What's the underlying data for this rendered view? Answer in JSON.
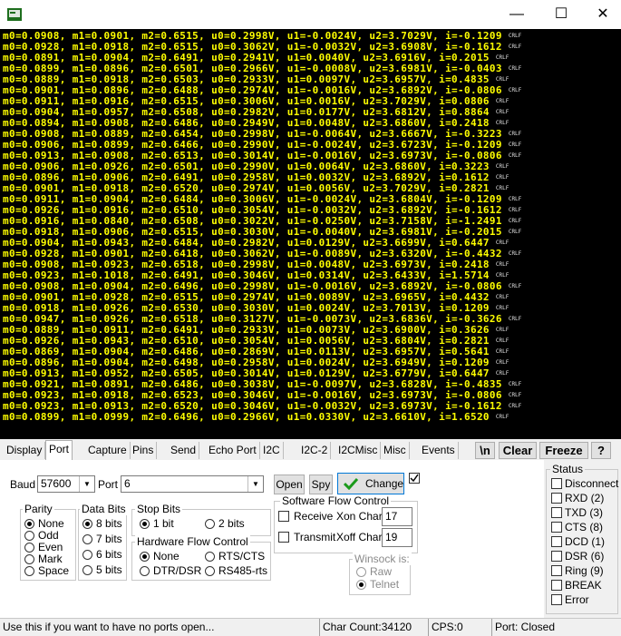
{
  "window": {
    "minimize": "—",
    "maximize": "☐",
    "close": "✕"
  },
  "terminal": {
    "crlf": "CRLF",
    "lines": [
      "m0=0.0908, m1=0.0901, m2=0.6515, u0=0.2998V, u1=-0.0024V, u2=3.7029V, i=-0.1209",
      "m0=0.0928, m1=0.0918, m2=0.6515, u0=0.3062V, u1=-0.0032V, u2=3.6908V, i=-0.1612",
      "m0=0.0891, m1=0.0904, m2=0.6491, u0=0.2941V, u1=0.0040V, u2=3.6916V, i=0.2015",
      "m0=0.0899, m1=0.0896, m2=0.6501, u0=0.2966V, u1=-0.0008V, u2=3.6981V, i=-0.0403",
      "m0=0.0889, m1=0.0918, m2=0.6503, u0=0.2933V, u1=0.0097V, u2=3.6957V, i=0.4835",
      "m0=0.0901, m1=0.0896, m2=0.6488, u0=0.2974V, u1=-0.0016V, u2=3.6892V, i=-0.0806",
      "m0=0.0911, m1=0.0916, m2=0.6515, u0=0.3006V, u1=0.0016V, u2=3.7029V, i=0.0806",
      "m0=0.0904, m1=0.0957, m2=0.6508, u0=0.2982V, u1=0.0177V, u2=3.6812V, i=0.8864",
      "m0=0.0894, m1=0.0908, m2=0.6486, u0=0.2949V, u1=0.0048V, u2=3.6860V, i=0.2418",
      "m0=0.0908, m1=0.0889, m2=0.6454, u0=0.2998V, u1=-0.0064V, u2=3.6667V, i=-0.3223",
      "m0=0.0906, m1=0.0899, m2=0.6466, u0=0.2990V, u1=-0.0024V, u2=3.6723V, i=-0.1209",
      "m0=0.0913, m1=0.0908, m2=0.6513, u0=0.3014V, u1=-0.0016V, u2=3.6973V, i=-0.0806",
      "m0=0.0906, m1=0.0926, m2=0.6501, u0=0.2990V, u1=0.0064V, u2=3.6860V, i=0.3223",
      "m0=0.0896, m1=0.0906, m2=0.6491, u0=0.2958V, u1=0.0032V, u2=3.6892V, i=0.1612",
      "m0=0.0901, m1=0.0918, m2=0.6520, u0=0.2974V, u1=0.0056V, u2=3.7029V, i=0.2821",
      "m0=0.0911, m1=0.0904, m2=0.6484, u0=0.3006V, u1=-0.0024V, u2=3.6804V, i=-0.1209",
      "m0=0.0926, m1=0.0916, m2=0.6510, u0=0.3054V, u1=-0.0032V, u2=3.6892V, i=-0.1612",
      "m0=0.0916, m1=0.0840, m2=0.6508, u0=0.3022V, u1=-0.0250V, u2=3.7158V, i=-1.2491",
      "m0=0.0918, m1=0.0906, m2=0.6515, u0=0.3030V, u1=-0.0040V, u2=3.6981V, i=-0.2015",
      "m0=0.0904, m1=0.0943, m2=0.6484, u0=0.2982V, u1=0.0129V, u2=3.6699V, i=0.6447",
      "m0=0.0928, m1=0.0901, m2=0.6418, u0=0.3062V, u1=-0.0089V, u2=3.6320V, i=-0.4432",
      "m0=0.0908, m1=0.0923, m2=0.6518, u0=0.2998V, u1=0.0048V, u2=3.6973V, i=0.2418",
      "m0=0.0923, m1=0.1018, m2=0.6491, u0=0.3046V, u1=0.0314V, u2=3.6433V, i=1.5714",
      "m0=0.0908, m1=0.0904, m2=0.6496, u0=0.2998V, u1=-0.0016V, u2=3.6892V, i=-0.0806",
      "m0=0.0901, m1=0.0928, m2=0.6515, u0=0.2974V, u1=0.0089V, u2=3.6965V, i=0.4432",
      "m0=0.0918, m1=0.0926, m2=0.6530, u0=0.3030V, u1=0.0024V, u2=3.7013V, i=0.1209",
      "m0=0.0947, m1=0.0926, m2=0.6518, u0=0.3127V, u1=-0.0073V, u2=3.6836V, i=-0.3626",
      "m0=0.0889, m1=0.0911, m2=0.6491, u0=0.2933V, u1=0.0073V, u2=3.6900V, i=0.3626",
      "m0=0.0926, m1=0.0943, m2=0.6510, u0=0.3054V, u1=0.0056V, u2=3.6804V, i=0.2821",
      "m0=0.0869, m1=0.0904, m2=0.6486, u0=0.2869V, u1=0.0113V, u2=3.6957V, i=0.5641",
      "m0=0.0896, m1=0.0904, m2=0.6498, u0=0.2958V, u1=0.0024V, u2=3.6949V, i=0.1209",
      "m0=0.0913, m1=0.0952, m2=0.6505, u0=0.3014V, u1=0.0129V, u2=3.6779V, i=0.6447",
      "m0=0.0921, m1=0.0891, m2=0.6486, u0=0.3038V, u1=-0.0097V, u2=3.6828V, i=-0.4835",
      "m0=0.0923, m1=0.0918, m2=0.6523, u0=0.3046V, u1=-0.0016V, u2=3.6973V, i=-0.0806",
      "m0=0.0923, m1=0.0913, m2=0.6520, u0=0.3046V, u1=-0.0032V, u2=3.6973V, i=-0.1612",
      "m0=0.0899, m1=0.0999, m2=0.6496, u0=0.2966V, u1=0.0330V, u2=3.6610V, i=1.6520"
    ]
  },
  "tabs": [
    "Display",
    "Port",
    "Capture",
    "Pins",
    "Send",
    "Echo Port",
    "I2C",
    "I2C-2",
    "I2CMisc",
    "Misc",
    "Events"
  ],
  "toolbar": {
    "newline": "\\n",
    "clear": "Clear",
    "freeze": "Freeze",
    "help": "?"
  },
  "port": {
    "baud_label": "Baud",
    "baud_value": "57600",
    "port_label": "Port",
    "port_value": "6",
    "open": "Open",
    "spy": "Spy",
    "change": "Change"
  },
  "parity": {
    "title": "Parity",
    "options": [
      "None",
      "Odd",
      "Even",
      "Mark",
      "Space"
    ]
  },
  "databits": {
    "title": "Data Bits",
    "options": [
      "8 bits",
      "7 bits",
      "6 bits",
      "5 bits"
    ]
  },
  "stopbits": {
    "title": "Stop Bits",
    "options": [
      "1 bit",
      "2 bits"
    ]
  },
  "hwflow": {
    "title": "Hardware Flow Control",
    "options": [
      "None",
      "RTS/CTS",
      "DTR/DSR",
      "RS485-rts"
    ]
  },
  "swflow": {
    "title": "Software Flow Control",
    "receive": "Receive",
    "xon_label": "Xon Char:",
    "xon_value": "17",
    "transmit": "Transmit",
    "xoff_label": "Xoff Char:",
    "xoff_value": "19"
  },
  "winsock": {
    "title": "Winsock is:",
    "options": [
      "Raw",
      "Telnet"
    ]
  },
  "status": {
    "title": "Status",
    "items": [
      "Disconnect",
      "RXD (2)",
      "TXD (3)",
      "CTS (8)",
      "DCD (1)",
      "DSR (6)",
      "Ring (9)",
      "BREAK",
      "Error"
    ]
  },
  "statusbar": {
    "hint": "Use this if you want to have no ports open...",
    "char_count": "Char Count:34120",
    "cps": "CPS:0",
    "port_status": "Port: Closed"
  }
}
